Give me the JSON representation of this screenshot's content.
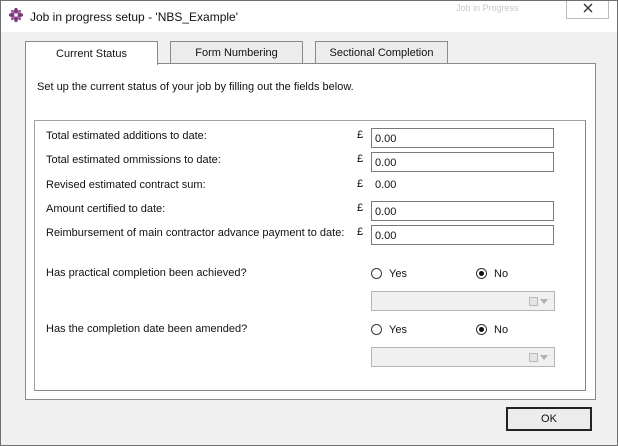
{
  "window": {
    "title": "Job in progress setup - 'NBS_Example'",
    "background_hint": "Job in Progress",
    "icon": "nbs-app-icon",
    "close_icon": "close-icon"
  },
  "tabs": [
    {
      "label": "Current Status",
      "active": true
    },
    {
      "label": "Form Numbering",
      "active": false
    },
    {
      "label": "Sectional Completion",
      "active": false
    }
  ],
  "current_status": {
    "intro": "Set up the current status of your job by filling out the fields below.",
    "currency_symbol": "£",
    "fields": {
      "additions": {
        "label": "Total estimated additions to date:",
        "value": "0.00"
      },
      "omissions": {
        "label": "Total estimated ommissions to date:",
        "value": "0.00"
      },
      "revised": {
        "label": "Revised estimated contract sum:",
        "value": "0.00"
      },
      "certified": {
        "label": "Amount certified to date:",
        "value": "0.00"
      },
      "reimbursement": {
        "label": "Reimbursement of main contractor advance payment to date:",
        "value": "0.00"
      }
    },
    "practical_completion": {
      "question": "Has practical completion been achieved?",
      "yes_label": "Yes",
      "no_label": "No",
      "selected": "No",
      "date_value": ""
    },
    "completion_amended": {
      "question": "Has the completion date been amended?",
      "yes_label": "Yes",
      "no_label": "No",
      "selected": "No",
      "date_value": ""
    }
  },
  "buttons": {
    "ok": "OK"
  }
}
